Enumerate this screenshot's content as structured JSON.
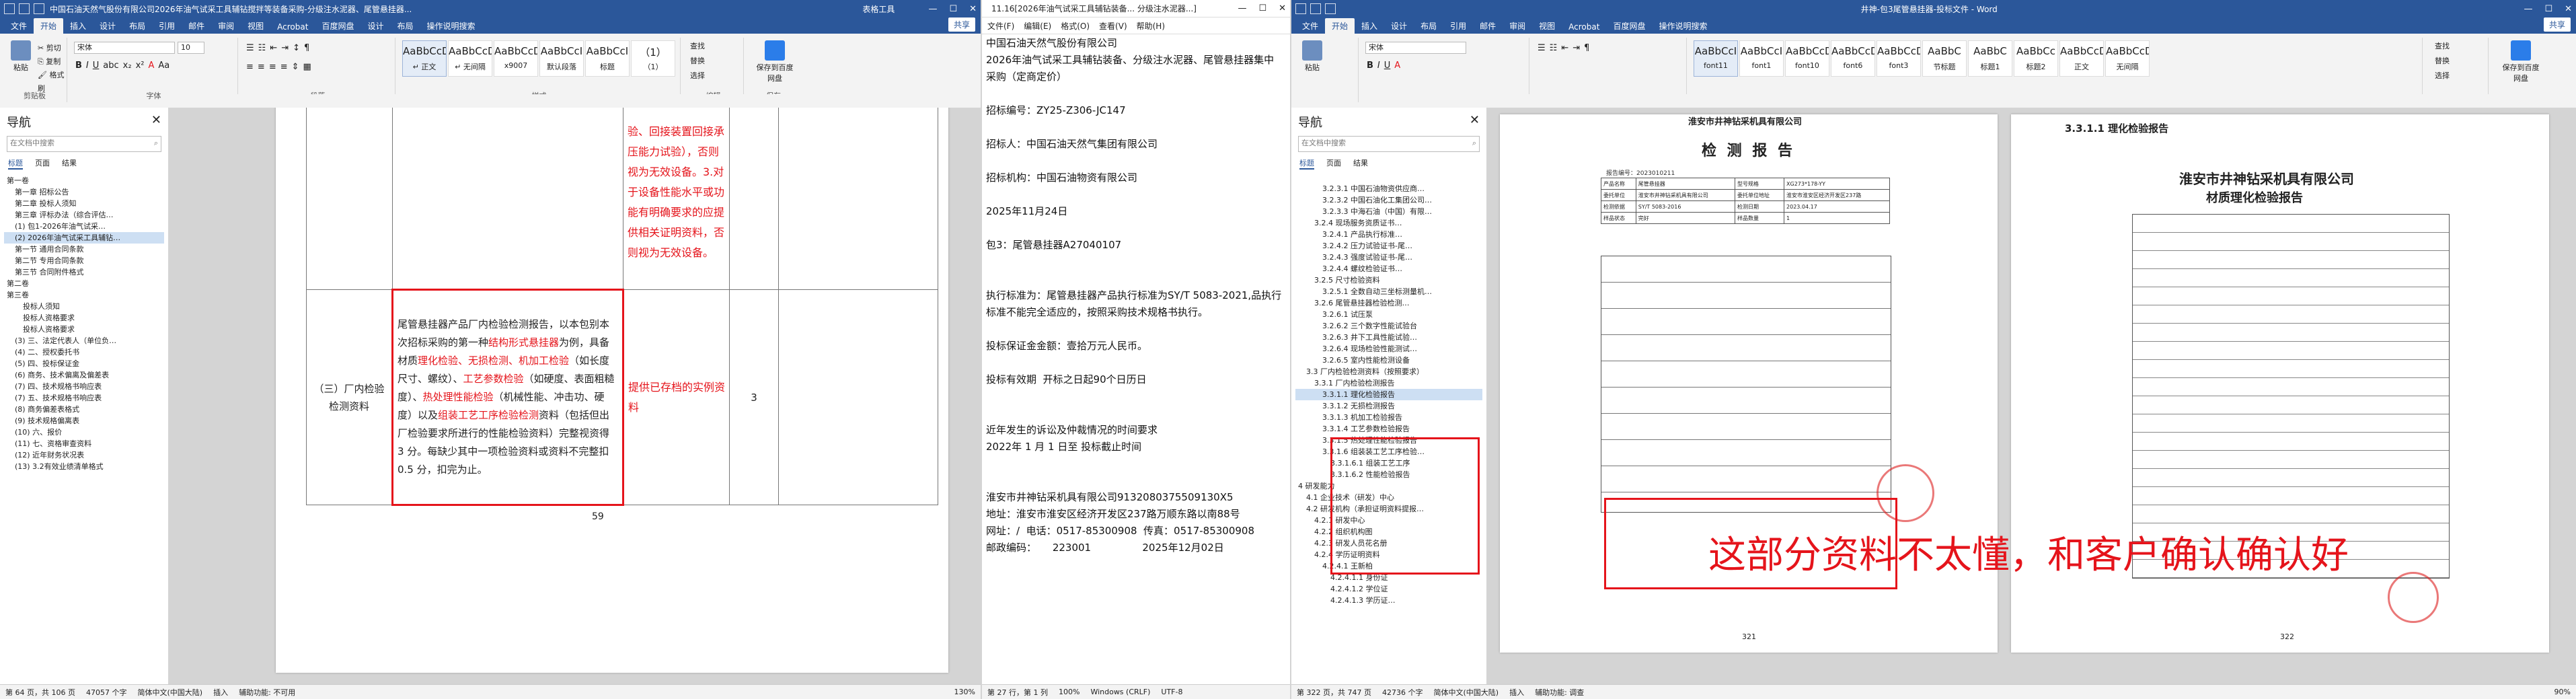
{
  "left_window": {
    "title": "中国石油天然气股份有限公司2026年油气试采工具辅钻搅拌等装备采购-分级注水泥器、尾管悬挂器...",
    "title_tools": "表格工具",
    "menu_tabs": [
      "文件",
      "开始",
      "插入",
      "设计",
      "布局",
      "引用",
      "邮件",
      "审阅",
      "视图",
      "Acrobat",
      "百度网盘",
      "设计",
      "布局",
      "操作说明搜索"
    ],
    "share": "共享",
    "ribbon": {
      "paste": "粘贴",
      "clipboard": "剪贴板",
      "font_name": "宋体",
      "font_size": "10",
      "font_group": "字体",
      "paragraph_group": "段落",
      "styles": [
        {
          "preview": "AaBbCcDd",
          "name": "↵ 正文"
        },
        {
          "preview": "AaBbCcDd",
          "name": "↵ 无间隔"
        },
        {
          "preview": "AaBbCcDd",
          "name": "x9007"
        },
        {
          "preview": "AaBbCcI",
          "name": "默认段落"
        },
        {
          "preview": "AaBbCcI",
          "name": "标题"
        },
        {
          "preview": "（1）",
          "name": "（1）"
        }
      ],
      "styles_group": "样式",
      "edit_items": [
        "查找",
        "替换",
        "选择"
      ],
      "edit_group": "编辑",
      "save_to": "保存到百度网盘",
      "save_group": "保存"
    },
    "nav": {
      "title": "导航",
      "search_placeholder": "在文档中搜索",
      "tabs": [
        "标题",
        "页面",
        "结果"
      ],
      "items": [
        {
          "text": "第一卷",
          "level": 0
        },
        {
          "text": "第一章 招标公告",
          "level": 1
        },
        {
          "text": "第二章 投标人须知",
          "level": 1
        },
        {
          "text": "第三章 评标办法（综合评估…",
          "level": 1
        },
        {
          "text": "(1) 包1-2026年油气试采…",
          "level": 1
        },
        {
          "text": "(2) 2026年油气试采工具辅钻…",
          "level": 1,
          "selected": true
        },
        {
          "text": "第一节 通用合同条款",
          "level": 1
        },
        {
          "text": "第二节 专用合同条款",
          "level": 1
        },
        {
          "text": "第三节 合同附件格式",
          "level": 1
        },
        {
          "text": "第二卷",
          "level": 0
        },
        {
          "text": "第三卷",
          "level": 0
        },
        {
          "text": "投标人须知",
          "level": 2
        },
        {
          "text": "投标人资格要求",
          "level": 2
        },
        {
          "text": "投标人资格要求",
          "level": 2
        },
        {
          "text": "(3) 三、法定代表人（单位负…",
          "level": 1
        },
        {
          "text": "(4) 二、授权委托书",
          "level": 1
        },
        {
          "text": "(5) 四、投标保证金",
          "level": 1
        },
        {
          "text": "(6) 商务、技术偏离及偏差表",
          "level": 1
        },
        {
          "text": "(7) 四、技术规格书响应表",
          "level": 1
        },
        {
          "text": "(7) 五、技术规格书响应表",
          "level": 1
        },
        {
          "text": "(8) 商务偏差表格式",
          "level": 1
        },
        {
          "text": "(9) 技术规格偏离表",
          "level": 1
        },
        {
          "text": "(10) 六、报价",
          "level": 1
        },
        {
          "text": "(11) 七、资格审查资料",
          "level": 1
        },
        {
          "text": "(12) 近年财务状况表",
          "level": 1
        },
        {
          "text": "(13) 3.2有效业绩清单格式",
          "level": 1
        }
      ]
    },
    "doc": {
      "top_right_text": "验、回接装置回接承压能力试验），否则视为无效设备。3.对于设备性能水平或功能有明确要求的应提供相关证明资料，否则视为无效设备。",
      "row_label": "（三）厂内检验检测资料",
      "main_text_a": "尾管悬挂器产品厂内检验检测报告，以本包别本次招标采购的第一种",
      "main_text_red1": "结构形式悬挂器",
      "main_text_b": "为例，具备材质",
      "main_text_red2": "理化检验、无损检测、机加工检验",
      "main_text_c": "（如长度尺寸、螺纹）、",
      "main_text_red3": "工艺参数检验",
      "main_text_d": "（如硬度、表面粗糙度）、",
      "main_text_red4": "热处理性能检验",
      "main_text_e": "（机械性能、冲击功、硬度）以及",
      "main_text_red5": "组装工艺工序检验检测",
      "main_text_f": "资料（包括但出厂检验要求所进行的性能检验资料）完整视资得 3 分。每缺少其中一项检验资料或资料不完整扣 0.5 分，扣完为止。",
      "evidence": "提供已存档的实例资料",
      "score": "3",
      "page_num": "59"
    },
    "status": {
      "page": "第 64 页，共 106 页",
      "words": "47057 个字",
      "lang": "简体中文(中国大陆)",
      "insert": "插入",
      "accessibility": "辅助功能: 不可用",
      "zoom": "130%"
    }
  },
  "notepad": {
    "title": "11.16[2026年油气试采工具辅钻装备... 分级注水泥器...]",
    "menu": [
      "文件(F)",
      "编辑(E)",
      "格式(O)",
      "查看(V)",
      "帮助(H)"
    ],
    "lines": [
      "中国石油天然气股份有限公司",
      "2026年油气试采工具辅钻装备、分级注水泥器、尾管悬挂器集中采购（定商定价）",
      "",
      "招标编号：ZY25-Z306-JC147",
      "",
      "招标人：中国石油天然气集团有限公司",
      "",
      "招标机构：中国石油物资有限公司",
      "",
      "2025年11月24日",
      "",
      "包3：尾管悬挂器A27040107",
      "",
      "",
      "执行标准为：尾管悬挂器产品执行标准为SY/T 5083-2021,品执行标准不能完全适应的，按照采购技术规格书执行。",
      "",
      "投标保证金金额：壹拾万元人民币。",
      "",
      "投标有效期  开标之日起90个日历日",
      "",
      "",
      "近年发生的诉讼及仲裁情况的时间要求",
      "2022年 1 月 1 日至 投标截止时间",
      "",
      "",
      "淮安市井神钻采机具有限公司9132080375509130X5",
      "地址：淮安市淮安区经济开发区237路万顺东路以南88号",
      "网址：/  电话：0517-85300908  传真：0517-85300908",
      "邮政编码：     223001                2025年12月02日"
    ],
    "status": {
      "pos": "第 27 行，第 1 列",
      "zoom": "100%",
      "eol": "Windows (CRLF)",
      "enc": "UTF-8"
    }
  },
  "right_window": {
    "title": "井神-包3尾管悬挂器-投标文件 - Word",
    "menu_tabs": [
      "文件",
      "开始",
      "插入",
      "设计",
      "布局",
      "引用",
      "邮件",
      "审阅",
      "视图",
      "Acrobat",
      "百度网盘",
      "操作说明搜索"
    ],
    "share": "共享",
    "ribbon": {
      "styles": [
        {
          "preview": "AaBbCcI",
          "name": "font11"
        },
        {
          "preview": "AaBbCcI",
          "name": "font1"
        },
        {
          "preview": "AaBbCcD",
          "name": "font10"
        },
        {
          "preview": "AaBbCcD",
          "name": "font6"
        },
        {
          "preview": "AaBbCcD",
          "name": "font3"
        },
        {
          "preview": "AaBbC",
          "name": "节标题"
        },
        {
          "preview": "AaBbC",
          "name": "标题1"
        },
        {
          "preview": "AaBbCc",
          "name": "标题2"
        },
        {
          "preview": "AaBbCcD",
          "name": "正文"
        },
        {
          "preview": "AaBbCcDd",
          "name": "无间隔"
        }
      ],
      "edit_items": [
        "查找",
        "替换",
        "选择"
      ]
    },
    "nav": {
      "title": "导航",
      "search_placeholder": "在文档中搜索",
      "tabs": [
        "标题",
        "页面",
        "结果"
      ],
      "items": [
        {
          "text": "3.2.3.1 中国石油物资供应商…",
          "level": 3
        },
        {
          "text": "3.2.3.2 中国石油化工集团公司…",
          "level": 3
        },
        {
          "text": "3.2.3.3 中海石油（中国）有限…",
          "level": 3
        },
        {
          "text": "3.2.4 现场服务资质证书…",
          "level": 2
        },
        {
          "text": "3.2.4.1 产品执行标准…",
          "level": 3
        },
        {
          "text": "3.2.4.2 压力试验证书-尾…",
          "level": 3
        },
        {
          "text": "3.2.4.3 强度试验证书-尾…",
          "level": 3
        },
        {
          "text": "3.2.4.4 螺纹检验证书…",
          "level": 3
        },
        {
          "text": "3.2.5 尺寸检验资料",
          "level": 2
        },
        {
          "text": "3.2.5.1 全数自动三坐标测量机…",
          "level": 3
        },
        {
          "text": "3.2.6 尾管悬挂器检验检测…",
          "level": 2
        },
        {
          "text": "3.2.6.1 试压泵",
          "level": 3
        },
        {
          "text": "3.2.6.2 三个数字性能试验台",
          "level": 3
        },
        {
          "text": "3.2.6.3 井下工具性能试验…",
          "level": 3
        },
        {
          "text": "3.2.6.4 现场检验性能测试…",
          "level": 3
        },
        {
          "text": "3.2.6.5 室内性能检测设备",
          "level": 3
        },
        {
          "text": "3.3 厂内检验检测资料（按照要求）",
          "level": 1
        },
        {
          "text": "3.3.1 厂内检验检测报告",
          "level": 2
        },
        {
          "text": "3.3.1.1 理化检验报告",
          "level": 3,
          "selected": true
        },
        {
          "text": "3.3.1.2 无损检测报告",
          "level": 3
        },
        {
          "text": "3.3.1.3 机加工检验报告",
          "level": 3
        },
        {
          "text": "3.3.1.4 工艺参数检验报告",
          "level": 3
        },
        {
          "text": "3.3.1.5 热处理性能检验报告",
          "level": 3
        },
        {
          "text": "3.3.1.6 组装装工艺工序检验…",
          "level": 3
        },
        {
          "text": "3.3.1.6.1 组装工艺工序",
          "level": 4
        },
        {
          "text": "3.3.1.6.2 性能检验报告",
          "level": 4
        },
        {
          "text": "4 研发能力",
          "level": 0
        },
        {
          "text": "4.1 企业技术（研发）中心",
          "level": 1
        },
        {
          "text": "4.2 研发机构（承担证明资料提报…",
          "level": 1
        },
        {
          "text": "4.2.1 研发中心",
          "level": 2
        },
        {
          "text": "4.2.2 组织机构图",
          "level": 2
        },
        {
          "text": "4.2.3 研发人员花名册",
          "level": 2
        },
        {
          "text": "4.2.4 学历证明资料",
          "level": 2
        },
        {
          "text": "4.2.4.1 王新柏",
          "level": 3
        },
        {
          "text": "4.2.4.1.1 身份证",
          "level": 4
        },
        {
          "text": "4.2.4.1.2 学位证",
          "level": 4
        },
        {
          "text": "4.2.4.1.3 学历证…",
          "level": 4
        }
      ]
    },
    "report_page": {
      "company_top": "淮安市井神钻采机具有限公司",
      "title": "检 测 报 告",
      "report_no": "报告编号：2023010211",
      "rows": [
        [
          "产品名称",
          "尾管悬挂器",
          "型号规格",
          "XG273*178-YY"
        ],
        [
          "委托单位",
          "淮安市井神钻采机具有限公司",
          "委托单位地址",
          "淮安市淮安区经济开发区237路"
        ],
        [
          "检测依据",
          "SY/T 5083-2016",
          "检测日期",
          "2023.04.17"
        ],
        [
          "样品状态",
          "完好",
          "样品数量",
          "1"
        ]
      ],
      "footer_page": "321"
    },
    "material_page": {
      "heading": "3.3.1.1 理化检验报告",
      "company": "淮安市井神钻采机具有限公司",
      "title": "材质理化检验报告",
      "footer_page": "322"
    },
    "annotation": "这部分资料不太懂，和客户确认确认好",
    "status": {
      "page": "第 322 页，共 747 页",
      "words": "42736 个字",
      "lang": "简体中文(中国大陆)",
      "insert": "插入",
      "accessibility": "辅助功能: 调查",
      "zoom": "90%"
    }
  }
}
